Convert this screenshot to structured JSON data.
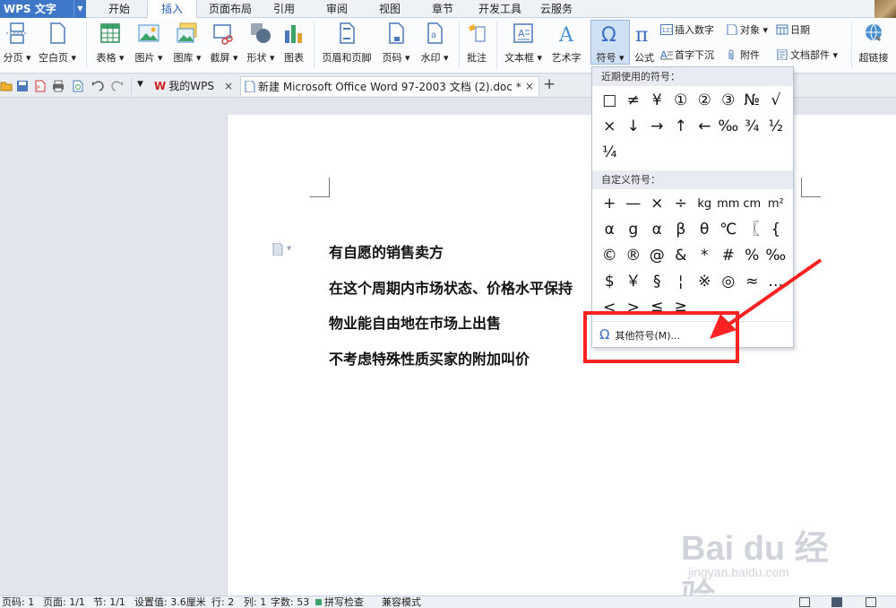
{
  "app": {
    "name": "WPS 文字"
  },
  "menu_tabs": [
    "开始",
    "插入",
    "页面布局",
    "引用",
    "审阅",
    "视图",
    "章节",
    "开发工具",
    "云服务"
  ],
  "ribbon": {
    "page_break": "分页",
    "blank_page": "空白页",
    "table": "表格",
    "picture": "图片",
    "gallery": "图库",
    "screenshot": "截屏",
    "shape": "形状",
    "chart": "图表",
    "header_footer": "页眉和页脚",
    "page_number": "页码",
    "watermark": "水印",
    "comment": "批注",
    "text_box": "文本框",
    "word_art": "艺术字",
    "symbol": "符号",
    "formula": "公式",
    "insert_number": "插入数字",
    "object": "对象",
    "date": "日期",
    "drop_cap": "首字下沉",
    "attachment": "附件",
    "doc_parts": "文档部件",
    "hyperlink": "超链接"
  },
  "doc_tabs": [
    {
      "label": "我的WPS"
    },
    {
      "label": "新建 Microsoft Office Word 97-2003 文档 (2).doc *"
    }
  ],
  "document": {
    "paragraphs": [
      "有自愿的销售卖方",
      "在这个周期内市场状态、价格水平保持",
      "物业能自由地在市场上出售",
      "不考虑特殊性质买家的附加叫价"
    ]
  },
  "symbol_dropdown": {
    "recent_title": "近期使用的符号：",
    "recent_symbols": [
      "□",
      "≠",
      "¥",
      "①",
      "②",
      "③",
      "№",
      "√",
      "×",
      "↓",
      "→",
      "↑",
      "←",
      "‰",
      "¾",
      "½",
      "¼"
    ],
    "custom_title": "自定义符号：",
    "custom_symbols": [
      "+",
      "—",
      "×",
      "÷",
      "kg",
      "mm",
      "cm",
      "m²",
      "α",
      "g",
      "α",
      "β",
      "θ",
      "℃",
      "〖",
      "{",
      "©",
      "®",
      "@",
      "&",
      "*",
      "#",
      "%",
      "‰",
      "$",
      "￥",
      "§",
      "¦",
      "※",
      "◎",
      "≈",
      "…",
      "<",
      ">",
      "≦",
      "≧"
    ],
    "more_label": "其他符号(M)..."
  },
  "status_bar": {
    "page_number": "页码: 1",
    "pages": "页面: 1/1",
    "section": "节: 1/1",
    "position": "设置值: 3.6厘米",
    "line": "行: 2",
    "column": "列: 1",
    "word_count": "字数: 53",
    "spell_check": "拼写检查",
    "compat_mode": "兼容模式"
  },
  "watermark": {
    "main": "Bai du 经验",
    "sub": "jingyan.baidu.com"
  },
  "colors": {
    "accent": "#3f77c8",
    "annotation": "#ff2222"
  }
}
